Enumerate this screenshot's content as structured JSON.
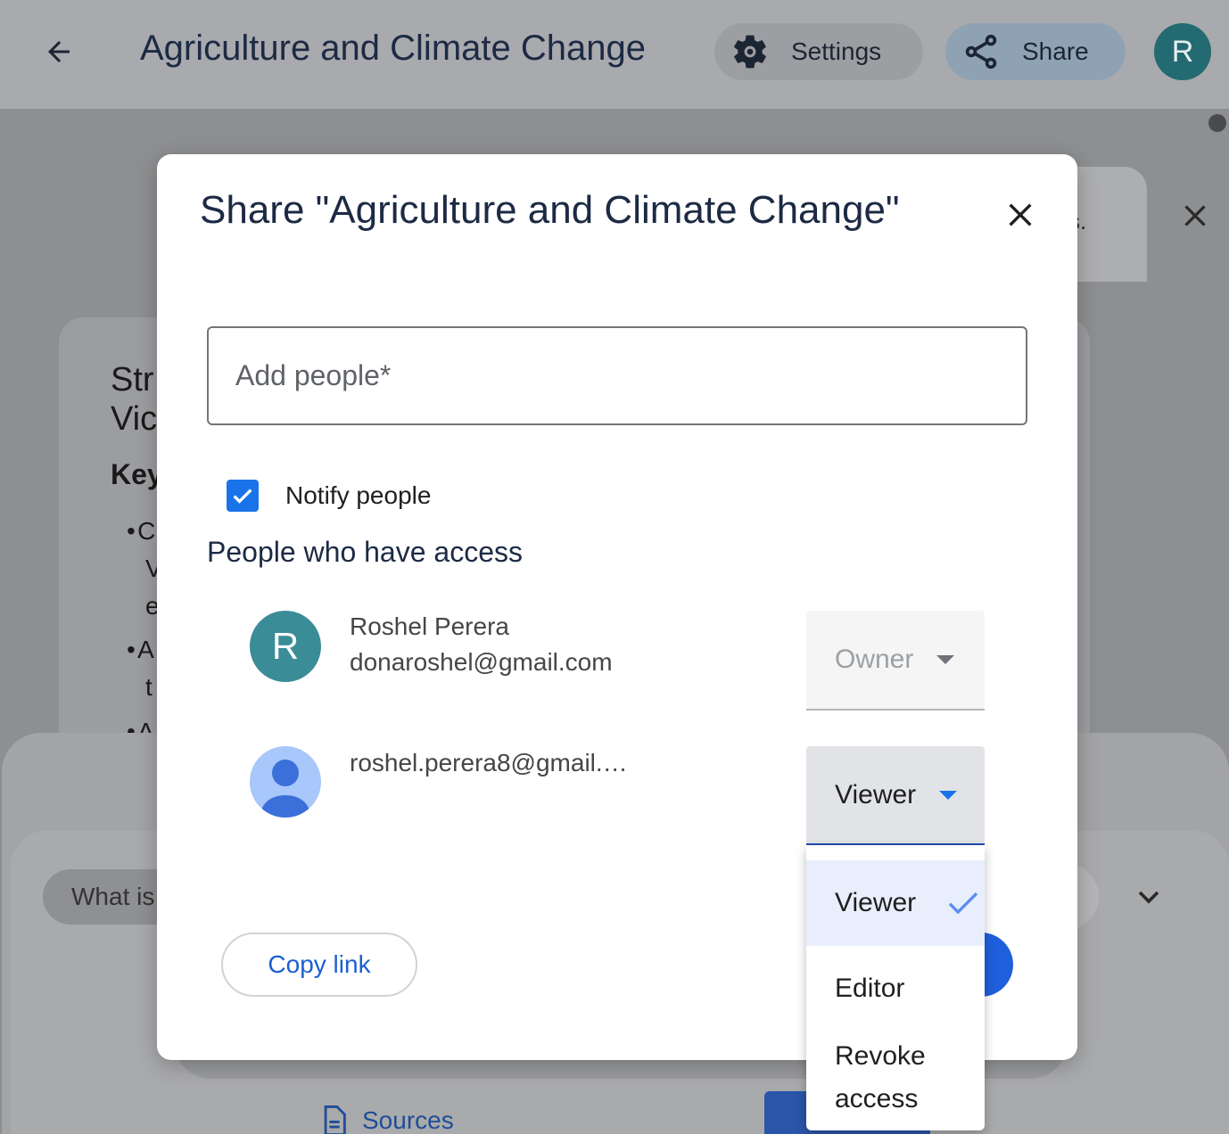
{
  "topbar": {
    "title": "Agriculture and Climate Change",
    "settings_label": "Settings",
    "share_label": "Share",
    "avatar_letter": "R"
  },
  "background": {
    "tooltip_fragment": "s.",
    "heading_line1": "Str",
    "heading_line2": "Vic",
    "key_fragment": "Key",
    "bullets": [
      "C",
      "V",
      "e",
      "A",
      "t",
      "A"
    ],
    "chat_placeholder_fragment": "What is",
    "sources_label": "Sources"
  },
  "dialog": {
    "title": "Share \"Agriculture and Climate Change\"",
    "add_people_placeholder": "Add people*",
    "notify_label": "Notify people",
    "notify_checked": true,
    "access_heading": "People who have access",
    "people": [
      {
        "avatar_letter": "R",
        "name": "Roshel Perera",
        "email": "donaroshel@gmail.com",
        "role": "Owner"
      },
      {
        "email": "roshel.perera8@gmail.…",
        "role": "Viewer"
      }
    ],
    "copy_link_label": "Copy link"
  },
  "role_menu": {
    "options": [
      "Viewer",
      "Editor",
      "Revoke access"
    ],
    "selected": "Viewer"
  },
  "colors": {
    "accent": "#1a73e8",
    "owner_avatar": "#3a8c96",
    "link": "#1a5fd1",
    "menu_selected_bg": "#e8eefb"
  }
}
